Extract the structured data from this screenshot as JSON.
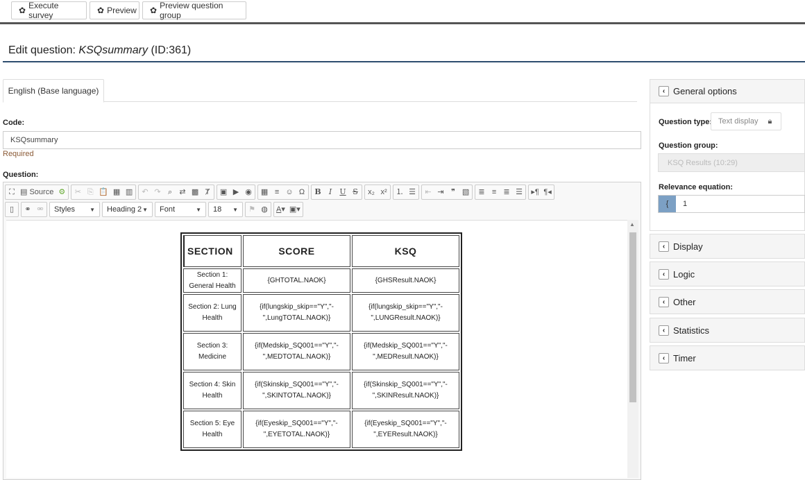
{
  "toolbar": {
    "execute_label": "Execute survey",
    "preview_label": "Preview",
    "preview_group_label": "Preview question group"
  },
  "page": {
    "title_prefix": "Edit question: ",
    "question_code": "KSQsummary",
    "id_label": "(ID:361)"
  },
  "language_tab": "English (Base language)",
  "code_field": {
    "label": "Code:",
    "value": "KSQsummary",
    "hint": "Required"
  },
  "question_field": {
    "label": "Question:"
  },
  "editor": {
    "source_label": "Source",
    "styles_combo": "Styles",
    "format_combo": "Heading 2",
    "font_combo": "Font",
    "size_combo": "18",
    "table": {
      "headers": [
        "SECTION",
        "SCORE",
        "KSQ"
      ],
      "rows": [
        {
          "section": "Section 1: General Health",
          "score": "{GHTOTAL.NAOK}",
          "ksq": "{GHSResult.NAOK}"
        },
        {
          "section": "Section 2: Lung Health",
          "score": "{if(lungskip_skip==\"Y\",\"-\",LungTOTAL.NAOK)}",
          "ksq": "{if(lungskip_skip==\"Y\",\"-\",LUNGResult.NAOK)}"
        },
        {
          "section": "Section 3: Medicine",
          "score": "{if(Medskip_SQ001==\"Y\",\"-\",MEDTOTAL.NAOK)}",
          "ksq": "{if(Medskip_SQ001==\"Y\",\"-\",MEDResult.NAOK)}"
        },
        {
          "section": "Section 4: Skin Health",
          "score": "{if(Skinskip_SQ001==\"Y\",\"-\",SKINTOTAL.NAOK)}",
          "ksq": "{if(Skinskip_SQ001==\"Y\",\"-\",SKINResult.NAOK)}"
        },
        {
          "section": "Section 5: Eye Health",
          "score": "{if(Eyeskip_SQ001==\"Y\",\"-\",EYETOTAL.NAOK)}",
          "ksq": "{if(Eyeskip_SQ001==\"Y\",\"-\",EYEResult.NAOK)}"
        }
      ]
    }
  },
  "sidebar": {
    "general_options": {
      "title": "General options",
      "question_type_label": "Question type:",
      "question_type_value": "Text display",
      "question_group_label": "Question group:",
      "question_group_value": "KSQ Results (10:29)",
      "relevance_label": "Relevance equation:",
      "relevance_addon": "{",
      "relevance_value": "1"
    },
    "sections": [
      "Display",
      "Logic",
      "Other",
      "Statistics",
      "Timer"
    ]
  },
  "colors": {
    "title_rule": "#2d4d6e",
    "relevance_addon": "#7ca0c4",
    "required_hint": "#8a5a36"
  },
  "icons": [
    "gear-icon",
    "chevron-left-icon",
    "lock-icon",
    "source-icon"
  ]
}
